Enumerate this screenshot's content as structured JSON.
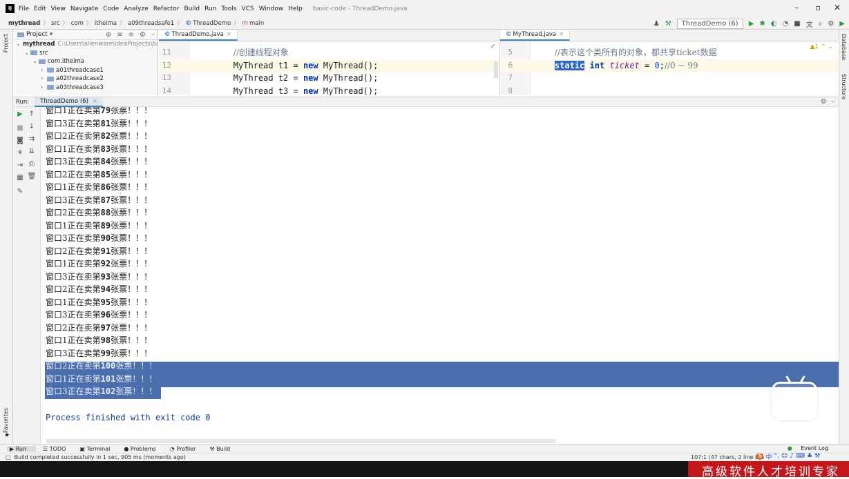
{
  "menubar": {
    "items": [
      "File",
      "Edit",
      "View",
      "Navigate",
      "Code",
      "Analyze",
      "Refactor",
      "Build",
      "Run",
      "Tools",
      "VCS",
      "Window",
      "Help"
    ],
    "window_title": "basic-code - ThreadDemo.java"
  },
  "navbar": {
    "crumbs": [
      "mythread",
      "src",
      "com",
      "itheima",
      "a09threadsafe1",
      "ThreadDemo",
      "main"
    ],
    "run_config": "ThreadDemo (6)"
  },
  "project": {
    "header": "Project",
    "root": "mythread",
    "root_path": "C:\\Users\\alienware\\IdeaProjects\\basic",
    "src": "src",
    "package": "com.itheima",
    "children": [
      "a01threadcase1",
      "a02threadcase2",
      "a03threadcase3"
    ]
  },
  "side": {
    "left_project": "Project",
    "left_structure": "Structure",
    "left_favorites": "Favorites",
    "right_database": "Database",
    "right_structure": "Structure"
  },
  "editor_left": {
    "tab": "ThreadDemo.java",
    "lines": [
      {
        "num": "11",
        "parts": [
          {
            "t": "        ",
            "c": ""
          },
          {
            "t": "//创建线程对象",
            "c": "cm"
          }
        ]
      },
      {
        "num": "12",
        "parts": [
          {
            "t": "        MyThread t1 = ",
            "c": ""
          },
          {
            "t": "new",
            "c": "kw"
          },
          {
            "t": " MyThread();",
            "c": ""
          }
        ]
      },
      {
        "num": "13",
        "parts": [
          {
            "t": "        MyThread t2 = ",
            "c": ""
          },
          {
            "t": "new",
            "c": "kw"
          },
          {
            "t": " MyThread();",
            "c": ""
          }
        ]
      },
      {
        "num": "14",
        "parts": [
          {
            "t": "        MyThread t3 = ",
            "c": ""
          },
          {
            "t": "new",
            "c": "kw"
          },
          {
            "t": " MyThread();",
            "c": ""
          }
        ]
      }
    ]
  },
  "editor_right": {
    "tab": "MyThread.java",
    "warning": "▲1",
    "lines": [
      {
        "num": "5",
        "parts": [
          {
            "t": "    ",
            "c": ""
          },
          {
            "t": "//表示这个类所有的对象，都共享ticket数据",
            "c": "cm"
          }
        ]
      },
      {
        "num": "6",
        "parts": [
          {
            "t": "    ",
            "c": ""
          },
          {
            "t": "static",
            "c": "selkw"
          },
          {
            "t": " ",
            "c": ""
          },
          {
            "t": "int",
            "c": "kw"
          },
          {
            "t": " ",
            "c": ""
          },
          {
            "t": "ticket",
            "c": "it"
          },
          {
            "t": " = ",
            "c": ""
          },
          {
            "t": "0",
            "c": "num"
          },
          {
            "t": ";",
            "c": ""
          },
          {
            "t": "//0 ~ 99",
            "c": "cm"
          }
        ]
      },
      {
        "num": "7",
        "parts": []
      },
      {
        "num": "8",
        "parts": []
      }
    ]
  },
  "run_panel": {
    "label": "Run:",
    "tab": "ThreadDemo (6)",
    "output": [
      {
        "pre": "窗口1正在卖第",
        "n": "79",
        "post": "张票！！！"
      },
      {
        "pre": "窗口3正在卖第",
        "n": "81",
        "post": "张票！！！"
      },
      {
        "pre": "窗口2正在卖第",
        "n": "82",
        "post": "张票！！！"
      },
      {
        "pre": "窗口1正在卖第",
        "n": "83",
        "post": "张票！！！"
      },
      {
        "pre": "窗口3正在卖第",
        "n": "84",
        "post": "张票！！！"
      },
      {
        "pre": "窗口2正在卖第",
        "n": "85",
        "post": "张票！！！"
      },
      {
        "pre": "窗口1正在卖第",
        "n": "86",
        "post": "张票！！！"
      },
      {
        "pre": "窗口3正在卖第",
        "n": "87",
        "post": "张票！！！"
      },
      {
        "pre": "窗口2正在卖第",
        "n": "88",
        "post": "张票！！！"
      },
      {
        "pre": "窗口1正在卖第",
        "n": "89",
        "post": "张票！！！"
      },
      {
        "pre": "窗口3正在卖第",
        "n": "90",
        "post": "张票！！！"
      },
      {
        "pre": "窗口2正在卖第",
        "n": "91",
        "post": "张票！！！"
      },
      {
        "pre": "窗口1正在卖第",
        "n": "92",
        "post": "张票！！！"
      },
      {
        "pre": "窗口3正在卖第",
        "n": "93",
        "post": "张票！！！"
      },
      {
        "pre": "窗口2正在卖第",
        "n": "94",
        "post": "张票！！！"
      },
      {
        "pre": "窗口1正在卖第",
        "n": "95",
        "post": "张票！！！"
      },
      {
        "pre": "窗口3正在卖第",
        "n": "96",
        "post": "张票！！！"
      },
      {
        "pre": "窗口2正在卖第",
        "n": "97",
        "post": "张票！！！"
      },
      {
        "pre": "窗口1正在卖第",
        "n": "98",
        "post": "张票！！！"
      },
      {
        "pre": "窗口3正在卖第",
        "n": "99",
        "post": "张票！！！"
      },
      {
        "pre": "窗口2正在卖第",
        "n": "100",
        "post": "张票！！！",
        "sel": true
      },
      {
        "pre": "窗口1正在卖第",
        "n": "101",
        "post": "张票！！！",
        "sel": true
      },
      {
        "pre": "窗口3正在卖第",
        "n": "102",
        "post": "张票！！！",
        "sel": true
      }
    ],
    "exit": "Process finished with exit code 0"
  },
  "bottom_tabs": [
    "Run",
    "TODO",
    "Terminal",
    "Problems",
    "Profiler",
    "Build"
  ],
  "event_log": "Event Log",
  "status": {
    "message": "Build completed successfully in 1 sec, 905 ms (moments ago)",
    "position": "107:1 (47 chars, 2 line bre"
  },
  "ime": {
    "zh": "中"
  },
  "banner": "高级软件人才培训专家",
  "colors": {
    "selection": "#4b6ead",
    "banner": "#c4171c",
    "keyword": "#0033b3"
  }
}
